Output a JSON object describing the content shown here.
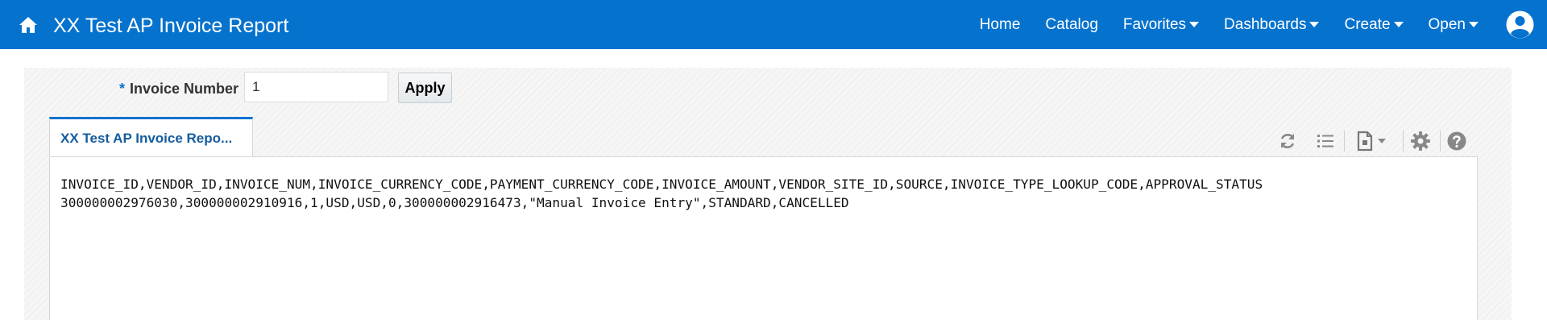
{
  "header": {
    "title": "XX Test AP Invoice Report",
    "nav": [
      {
        "label": "Home"
      },
      {
        "label": "Catalog"
      },
      {
        "label": "Favorites"
      },
      {
        "label": "Dashboards"
      },
      {
        "label": "Create"
      },
      {
        "label": "Open"
      }
    ],
    "icons": {
      "home": "home-icon",
      "user": "user-avatar-icon"
    }
  },
  "parameters": {
    "required_marker": "*",
    "invoice_number_label": "Invoice Number",
    "invoice_number_value": "1",
    "apply_label": "Apply"
  },
  "report": {
    "tab_label": "XX Test AP Invoice Repo...",
    "toolbar_icons": [
      "refresh-icon",
      "view-list-icon",
      "export-icon",
      "settings-icon",
      "help-icon"
    ],
    "output_lines": [
      "INVOICE_ID,VENDOR_ID,INVOICE_NUM,INVOICE_CURRENCY_CODE,PAYMENT_CURRENCY_CODE,INVOICE_AMOUNT,VENDOR_SITE_ID,SOURCE,INVOICE_TYPE_LOOKUP_CODE,APPROVAL_STATUS",
      "300000002976030,300000002910916,1,USD,USD,0,300000002916473,\"Manual Invoice Entry\",STANDARD,CANCELLED"
    ]
  },
  "colors": {
    "brand": "#0572ce",
    "tab_text": "#145c9e"
  }
}
